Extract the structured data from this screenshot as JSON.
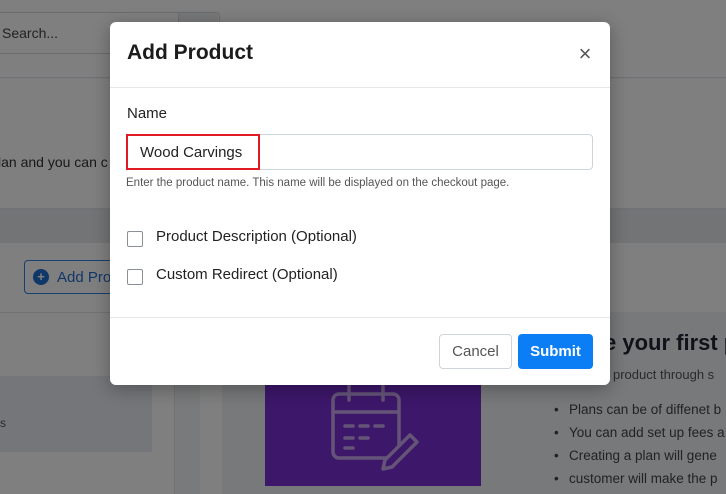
{
  "background": {
    "search_placeholder": "Search...",
    "plan_text": "lan and you can c",
    "add_button_label": "Add Pro",
    "left_list_text": "s",
    "heading": "e your first p",
    "subtext": "product through s",
    "bullets": [
      "Plans can be of diffenet b",
      "You can add set up fees a",
      "Creating a plan will gene",
      "customer will make the p"
    ]
  },
  "modal": {
    "title": "Add Product",
    "close_symbol": "×",
    "name_label": "Name",
    "name_value": "Wood Carvings",
    "name_help": "Enter the product name. This name will be displayed on the checkout page.",
    "options": [
      {
        "label": "Product Description (Optional)",
        "checked": false
      },
      {
        "label": "Custom Redirect (Optional)",
        "checked": false
      }
    ],
    "cancel_label": "Cancel",
    "submit_label": "Submit"
  },
  "colors": {
    "primary": "#0b7ef5",
    "highlight": "#e01b24",
    "purple_card": "#7b2ed4"
  }
}
